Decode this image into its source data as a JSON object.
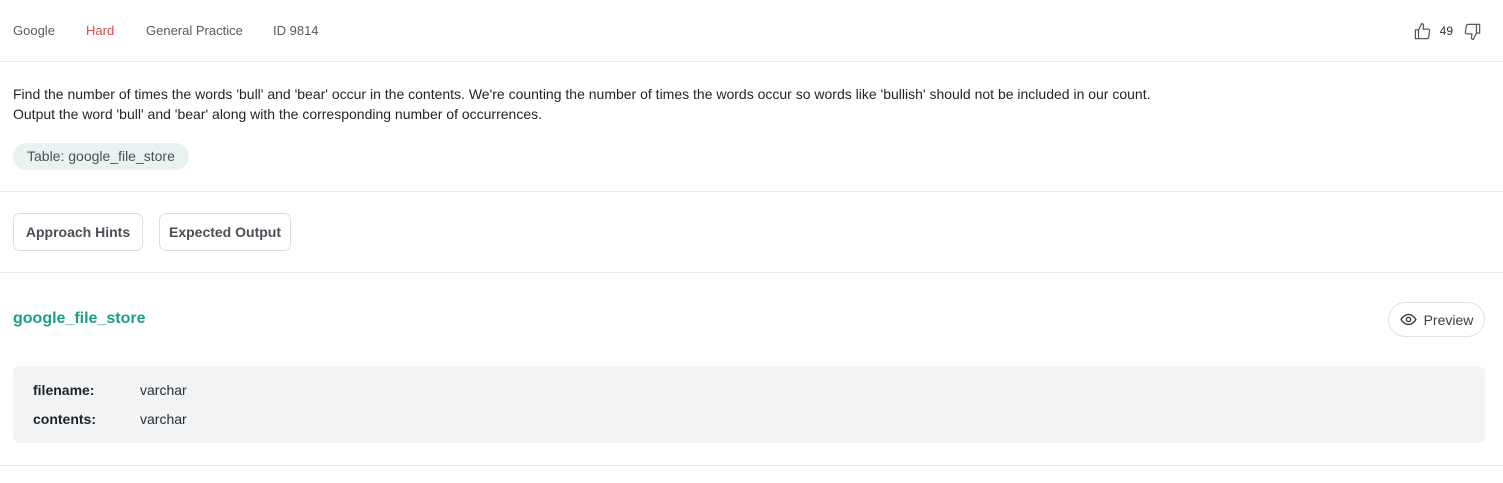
{
  "meta": {
    "company": "Google",
    "difficulty": "Hard",
    "category": "General Practice",
    "id": "ID 9814",
    "difficulty_color": "#d84a45"
  },
  "votes": {
    "count": "49",
    "upvote_icon": "thumbs-up-icon",
    "downvote_icon": "thumbs-down-icon"
  },
  "question": {
    "line1": "Find the number of times the words 'bull' and 'bear' occur in the contents. We're counting the number of times the words occur so words like 'bullish' should not be included in our count.",
    "line2": "Output the word 'bull' and 'bear' along with the corresponding number of occurrences."
  },
  "table_chip": "Table: google_file_store",
  "buttons": {
    "hints": "Approach Hints",
    "expected": "Expected Output"
  },
  "table": {
    "name": "google_file_store",
    "preview_label": "Preview",
    "preview_icon": "eye-icon",
    "accent": "#18a08a",
    "columns": [
      {
        "name": "filename:",
        "type": "varchar"
      },
      {
        "name": "contents:",
        "type": "varchar"
      }
    ]
  }
}
